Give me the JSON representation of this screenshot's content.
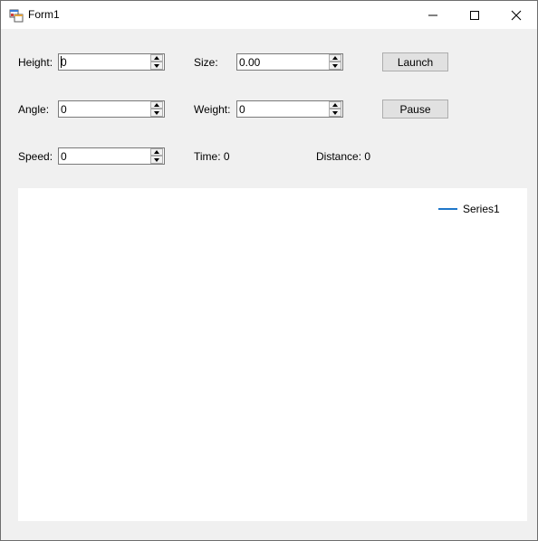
{
  "window": {
    "title": "Form1",
    "icon": "winforms-app-icon"
  },
  "titlebar_buttons": [
    {
      "name": "minimize-button",
      "icon": "minimize-icon"
    },
    {
      "name": "maximize-button",
      "icon": "maximize-icon"
    },
    {
      "name": "close-button",
      "icon": "close-icon"
    }
  ],
  "form": {
    "height_label": "Height:",
    "height_value": "0",
    "angle_label": "Angle:",
    "angle_value": "0",
    "speed_label": "Speed:",
    "speed_value": "0",
    "size_label": "Size:",
    "size_value": "0.00",
    "weight_label": "Weight:",
    "weight_value": "0",
    "time_label": "Time: 0",
    "distance_label": "Distance: 0",
    "launch_label": "Launch",
    "pause_label": "Pause"
  },
  "chart_data": {
    "type": "line",
    "series": [
      {
        "name": "Series1",
        "color": "#1f77c9",
        "values": []
      }
    ],
    "legend_position": "top-right",
    "background": "#ffffff"
  }
}
